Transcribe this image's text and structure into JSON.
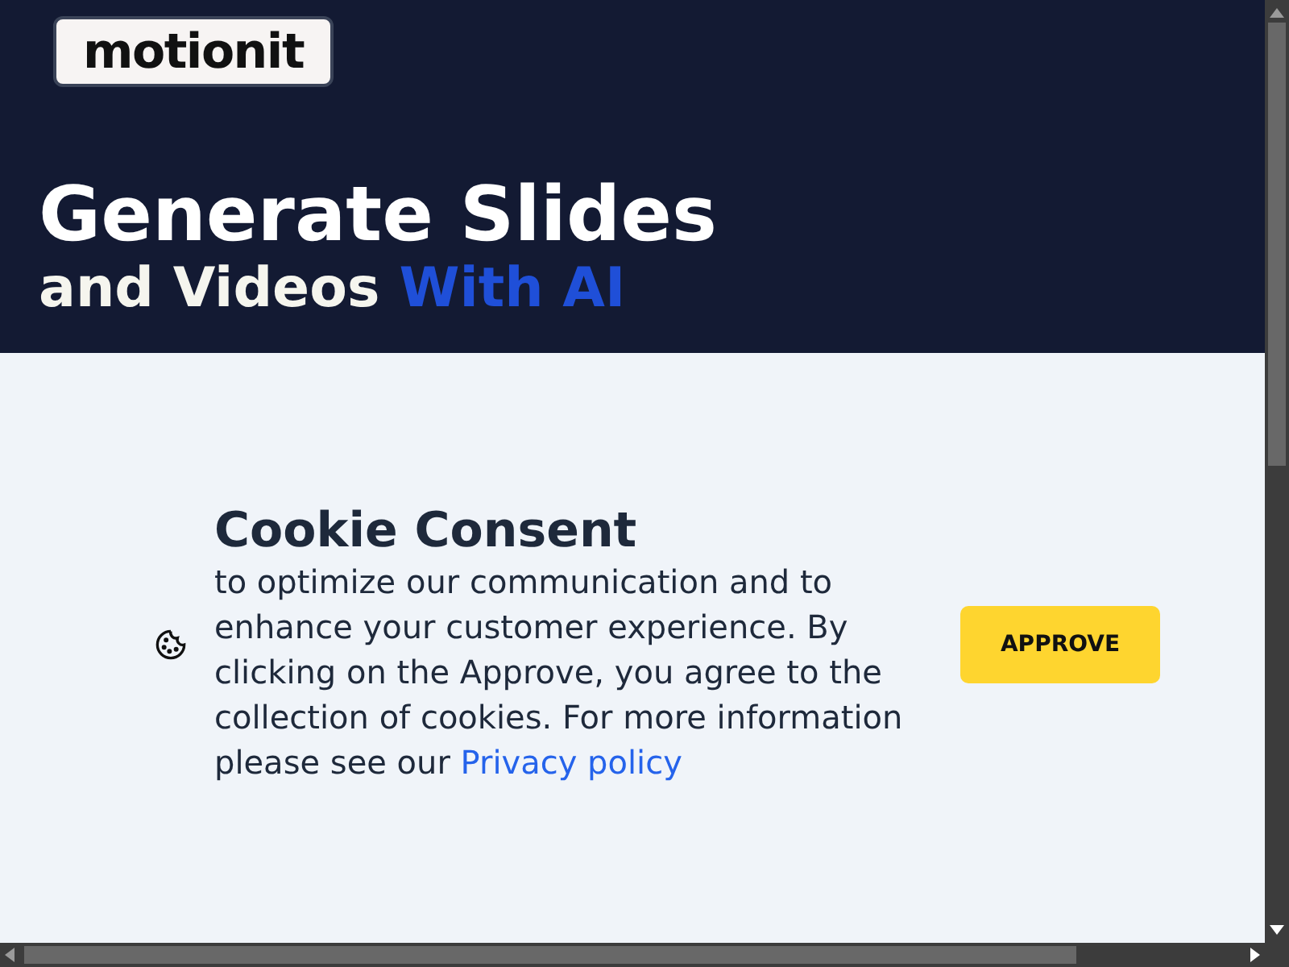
{
  "header": {
    "logo": "motionit",
    "headline": "Generate Slides",
    "subheadline": "and Videos",
    "subheadline_highlight": "With AI"
  },
  "cookie_consent": {
    "title": "Cookie Consent",
    "body": "to optimize our communication and to enhance your customer experience. By clicking on the Approve, you agree to the collection of cookies. For more information please see our",
    "link": "Privacy policy",
    "button": "APPROVE"
  }
}
